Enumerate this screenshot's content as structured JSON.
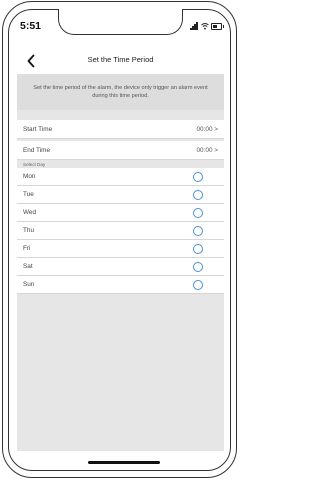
{
  "status_bar": {
    "time": "5:51"
  },
  "header": {
    "title": "Set the Time Period",
    "back_icon": "chevron-left-icon"
  },
  "description": "Set the time period of the alarm, the device only trigger an alarm event during this time period.",
  "settings": {
    "start_time": {
      "label": "Start Time",
      "value": "00:00 >"
    },
    "end_time": {
      "label": "End Time",
      "value": "00:00 >"
    }
  },
  "select_day": {
    "label": "Select Day",
    "days": [
      {
        "label": "Mon",
        "selected": false
      },
      {
        "label": "Tue",
        "selected": false
      },
      {
        "label": "Wed",
        "selected": false
      },
      {
        "label": "Thu",
        "selected": false
      },
      {
        "label": "Fri",
        "selected": false
      },
      {
        "label": "Sat",
        "selected": false
      },
      {
        "label": "Sun",
        "selected": false
      }
    ]
  },
  "colors": {
    "radio_accent": "#4a90d9",
    "screen_background": "#e6e6e6"
  }
}
